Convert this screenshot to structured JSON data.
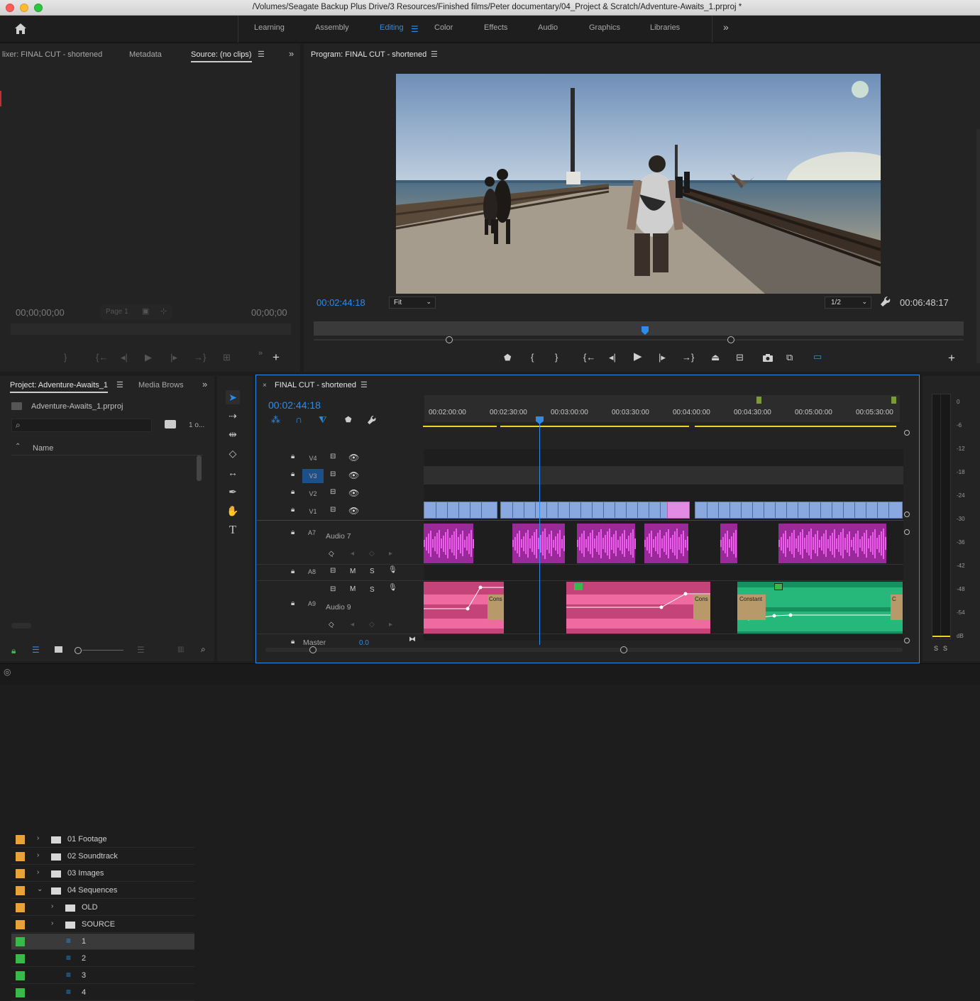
{
  "window": {
    "title": "/Volumes/Seagate Backup Plus Drive/3 Resources/Finished films/Peter documentary/04_Project & Scratch/Adventure-Awaits_1.prproj *"
  },
  "workspaces": {
    "tabs": [
      "Learning",
      "Assembly",
      "Editing",
      "Color",
      "Effects",
      "Audio",
      "Graphics",
      "Libraries"
    ],
    "active": "Editing",
    "more": "»"
  },
  "source_panel": {
    "tabs": [
      "lixer: FINAL CUT - shortened",
      "Metadata",
      "Source: (no clips)"
    ],
    "timecode_in": "00;00;00;00",
    "page": "Page 1",
    "timecode_out": "00;00;00"
  },
  "program_panel": {
    "title": "Program: FINAL CUT - shortened",
    "timecode": "00:02:44:18",
    "fit": "Fit",
    "resolution": "1/2",
    "duration": "00:06:48:17"
  },
  "project_panel": {
    "tab": "Project: Adventure-Awaits_1",
    "tab2": "Media Brows",
    "file": "Adventure-Awaits_1.prproj",
    "items_count": "1 o...",
    "column": "Name",
    "items": [
      {
        "label": "01 Footage",
        "color": "#e8a23a",
        "kind": "folder",
        "indent": 0,
        "expanded": false
      },
      {
        "label": "02 Soundtrack",
        "color": "#e8a23a",
        "kind": "folder",
        "indent": 0,
        "expanded": false
      },
      {
        "label": "03 Images",
        "color": "#e8a23a",
        "kind": "folder",
        "indent": 0,
        "expanded": false
      },
      {
        "label": "04 Sequences",
        "color": "#e8a23a",
        "kind": "folder",
        "indent": 0,
        "expanded": true
      },
      {
        "label": "OLD",
        "color": "#e8a23a",
        "kind": "folder",
        "indent": 1,
        "expanded": false
      },
      {
        "label": "SOURCE",
        "color": "#e8a23a",
        "kind": "folder",
        "indent": 1,
        "expanded": false
      },
      {
        "label": "1",
        "color": "#3cb84a",
        "kind": "sequence",
        "indent": 1,
        "selected": true
      },
      {
        "label": "2",
        "color": "#3cb84a",
        "kind": "sequence",
        "indent": 1
      },
      {
        "label": "3",
        "color": "#3cb84a",
        "kind": "sequence",
        "indent": 1
      },
      {
        "label": "4",
        "color": "#3cb84a",
        "kind": "sequence",
        "indent": 1
      }
    ]
  },
  "timeline": {
    "sequence": "FINAL CUT - shortened",
    "timecode": "00:02:44:18",
    "ruler": [
      "00:02:00:00",
      "00:02:30:00",
      "00:03:00:00",
      "00:03:30:00",
      "00:04:00:00",
      "00:04:30:00",
      "00:05:00:00",
      "00:05:30:00"
    ],
    "video_tracks": [
      "V4",
      "V3",
      "V2",
      "V1"
    ],
    "audio_tracks": [
      {
        "id": "A7",
        "name": "Audio 7"
      },
      {
        "id": "A8",
        "name": ""
      },
      {
        "id": "A9",
        "name": "Audio 9"
      }
    ],
    "master": "Master",
    "master_value": "0.0",
    "clip_labels": {
      "cons1": "Cons",
      "cons2": "Cons",
      "constant": "Constant",
      "c": "C"
    },
    "track_toggles": {
      "mute": "M",
      "solo": "S"
    }
  },
  "audio_meter": {
    "scale": [
      "0",
      "-6",
      "-12",
      "-18",
      "-24",
      "-30",
      "-36",
      "-42",
      "-48",
      "-54",
      "dB"
    ],
    "solo": [
      "S",
      "S"
    ]
  },
  "icons": {
    "home": "home-icon",
    "wrench": "wrench-icon",
    "camera": "camera-icon",
    "marker": "marker-icon"
  },
  "colors": {
    "accent": "#2d8ceb",
    "video_clip": "#8aa8e0",
    "audio_clip_purple": "#c02fc0",
    "audio_clip_pink": "#e8508f",
    "audio_clip_green": "#25b87a"
  }
}
